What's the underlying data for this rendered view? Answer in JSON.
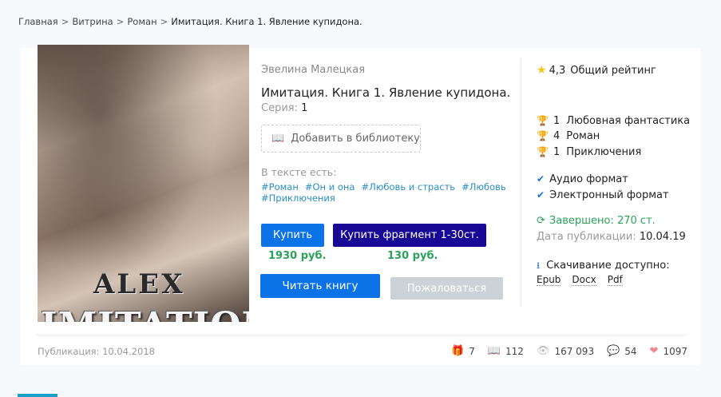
{
  "breadcrumb": {
    "items": [
      "Главная",
      "Витрина",
      "Роман"
    ],
    "separator": ">",
    "current": "Имитация. Книга 1. Явление купидона."
  },
  "cover": {
    "text_top": "ALEX",
    "text_bottom": "IMITATION"
  },
  "book": {
    "author": "Эвелина Малецкая",
    "title": "Имитация. Книга 1. Явление купидона.",
    "series_label": "Серия:",
    "series_value": "1",
    "add_to_library": "Добавить в библиотеку",
    "in_text_label": "В тексте есть:",
    "tags": [
      "#Роман",
      "#Он и она",
      "#Любовь и страсть",
      "#Любовь",
      "#Приключения"
    ]
  },
  "purchase": {
    "buy_label": "Купить",
    "buy_price": "1930 руб.",
    "fragment_label": "Купить фрагмент 1-30ст.",
    "fragment_price": "130 руб.",
    "read_label": "Читать книгу",
    "report_label": "Пожаловаться"
  },
  "side": {
    "rating_value": "4,3",
    "rating_label": "Общий рейтинг",
    "ranks": [
      {
        "place": "1",
        "genre": "Любовная фантастика"
      },
      {
        "place": "4",
        "genre": "Роман"
      },
      {
        "place": "1",
        "genre": "Приключения"
      }
    ],
    "formats_available": [
      "Аудио формат",
      "Электронный формат"
    ],
    "status": "Завершено: 270 ст.",
    "pubdate_label": "Дата публикации:",
    "pubdate_value": "10.04.19",
    "download_label": "Скачивание доступно:",
    "download_formats": [
      "Epub",
      "Docx",
      "Pdf"
    ]
  },
  "footer": {
    "publication": "Публикация: 10.04.2018",
    "gifts": "7",
    "libraries": "112",
    "views": "167 093",
    "comments": "54",
    "likes": "1097"
  },
  "colors": {
    "primary_button": "#0c72e8",
    "fragment_button": "#170996",
    "price": "#29a35a",
    "tag": "#2a8ec5",
    "star": "#f5c518"
  }
}
